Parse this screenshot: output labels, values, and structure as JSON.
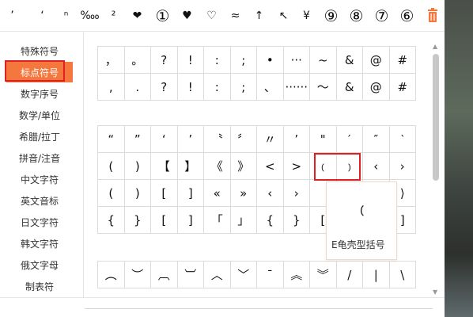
{
  "recent": [
    "’",
    "‘",
    "ⁿ",
    "‱",
    "²",
    "❤",
    "①",
    "♥",
    "♡",
    "≈",
    "↑",
    "↖",
    "¥",
    "⑨",
    "⑧",
    "⑦",
    "⑥"
  ],
  "sidebar": {
    "items": [
      {
        "label": "特殊符号"
      },
      {
        "label": "标点符号",
        "active": true
      },
      {
        "label": "数字序号"
      },
      {
        "label": "数学/单位"
      },
      {
        "label": "希腊/拉丁"
      },
      {
        "label": "拼音/注音"
      },
      {
        "label": "中文字符"
      },
      {
        "label": "英文音标"
      },
      {
        "label": "日文字符"
      },
      {
        "label": "韩文字符"
      },
      {
        "label": "俄文字母"
      },
      {
        "label": "制表符"
      }
    ]
  },
  "grid_a": [
    [
      "，",
      "。",
      "?",
      "!",
      ":",
      ";",
      "•",
      "···",
      "~",
      "&",
      "@",
      "#"
    ],
    [
      ",",
      ".",
      "?",
      "!",
      ":",
      ";",
      "、",
      "······",
      "～",
      "&",
      "@",
      "#"
    ]
  ],
  "grid_b": [
    [
      "“",
      "”",
      "‘",
      "’",
      "〝",
      "〞",
      "〃",
      "’",
      "\"",
      "′",
      "″",
      "‵"
    ],
    [
      "(",
      ")",
      "【",
      "】",
      "《",
      "》",
      "<",
      ">",
      "﹙",
      "﹚",
      "‹",
      "›"
    ],
    [
      "(",
      ")",
      "[",
      "]",
      "«",
      "»",
      "‹",
      "›",
      "",
      "",
      "",
      "⟩"
    ],
    [
      "{",
      "}",
      "[",
      "]",
      "「",
      "」",
      "{",
      "}",
      "[",
      "",
      "",
      "]"
    ]
  ],
  "grid_c": [
    [
      "︵",
      "︶",
      "︹",
      "︺",
      "︿",
      "﹀",
      "ˉ",
      "︽",
      "︾",
      "/",
      "|",
      "\\"
    ]
  ],
  "preview": {
    "char": "﹙",
    "name": "E龟壳型括号"
  },
  "colors": {
    "accent": "#f4773e",
    "highlight": "#e02020",
    "trash": "#f4773e"
  }
}
